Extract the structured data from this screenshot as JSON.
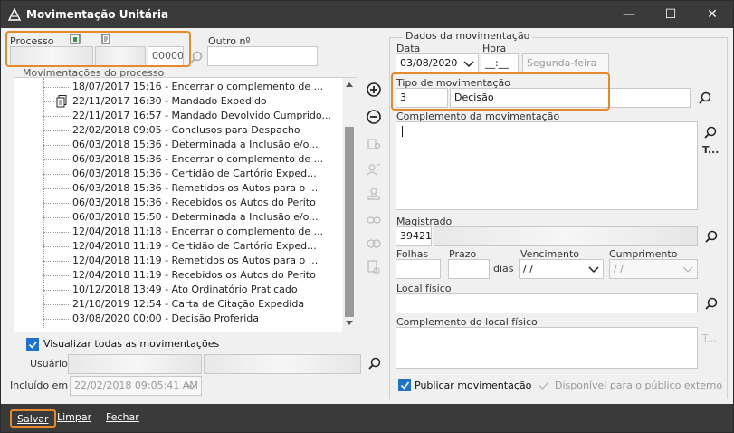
{
  "window": {
    "title": "Movimentação Unitária",
    "min_glyph": "—",
    "max_glyph": "☐",
    "close_glyph": "✕"
  },
  "processo": {
    "label": "Processo",
    "field_suffix": "00000",
    "outro_label": "Outro nº",
    "outro_value": ""
  },
  "movimentacoes": {
    "label": "Movimentações do processo",
    "items": [
      "18/07/2017 15:16 - Encerrar o complemento de ...",
      "22/11/2017 16:30 - Mandado Expedido",
      "22/11/2017 16:57 - Mandado Devolvido Cumprido...",
      "22/02/2018 09:05 - Conclusos para Despacho",
      "06/03/2018 15:36 - Determinada a Inclusão e/o...",
      "06/03/2018 15:36 - Encerrar o complemento de ...",
      "06/03/2018 15:36 - Certidão de Cartório Exped...",
      "06/03/2018 15:36 - Remetidos os Autos para o ...",
      "06/03/2018 15:36 - Recebidos os Autos do Perito",
      "06/03/2018 15:50 - Determinada a Inclusão e/o...",
      "12/04/2018 11:18 - Encerrar o complemento de ...",
      "12/04/2018 11:19 - Certidão de Cartório Exped...",
      "12/04/2018 11:19 - Remetidos os Autos para o ...",
      "12/04/2018 11:19 - Recebidos os Autos do Perito",
      "10/12/2018 13:49 - Ato Ordinatório Praticado",
      "21/10/2019 12:54 - Carta de Citação Expedida",
      "03/08/2020 00:00 - Decisão Proferida"
    ],
    "visualizar_todas_label": "Visualizar todas as movimentações",
    "usuario_label": "Usuário",
    "incluido_label": "Incluído em :",
    "incluido_value": "22/02/2018 09:05:41 AM"
  },
  "dados": {
    "legend": "Dados da movimentação",
    "data_label": "Data",
    "data_value": "03/08/2020",
    "hora_label": "Hora",
    "hora_value": "__:__",
    "weekday": "Segunda-feira",
    "tipo_label": "Tipo de movimentação",
    "tipo_code": "3",
    "tipo_desc": "Decisão",
    "complemento_label": "Complemento da movimentação",
    "complemento_side": "T...",
    "magistrado_label": "Magistrado",
    "magistrado_code": "39421",
    "folhas_label": "Folhas",
    "prazo_label": "Prazo",
    "dias_label": "dias",
    "vencimento_label": "Vencimento",
    "vencimento_value": " / /",
    "cumprimento_label": "Cumprimento",
    "cumprimento_value": " / /",
    "local_fisico_label": "Local físico",
    "complemento_local_label": "Complemento do local físico",
    "complemento_local_side": "T...",
    "publicar_label": "Publicar movimentação",
    "disponivel_label": "Disponível para o público externo"
  },
  "footer": {
    "salvar": "Salvar",
    "limpar": "Limpar",
    "fechar": "Fechar"
  },
  "colors": {
    "highlight": "#e38a2b",
    "titlebar": "#3a3a3a",
    "accent": "#1e73c8"
  }
}
